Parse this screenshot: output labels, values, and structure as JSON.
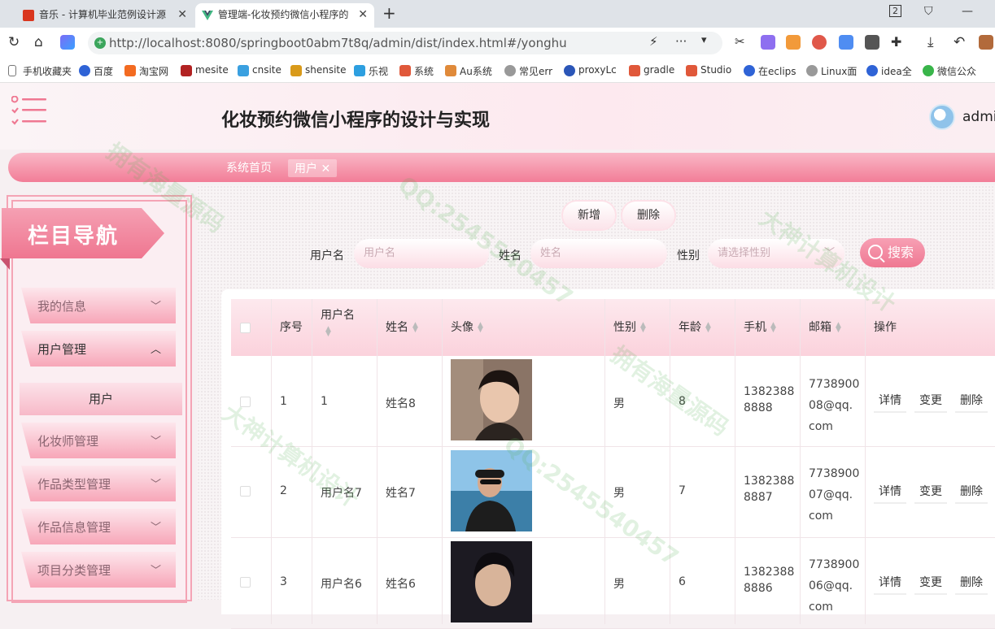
{
  "browser": {
    "tabs": [
      {
        "title": "音乐 - 计算机毕业范例设计源"
      },
      {
        "title": "管理端-化妆预约微信小程序的"
      }
    ],
    "tab_count_badge": "2",
    "url": "http://localhost:8080/springboot0abm7t8q/admin/dist/index.html#/yonghu",
    "bookmarks": [
      "手机收藏夹",
      "百度",
      "淘宝网",
      "mesite",
      "cnsite",
      "shensite",
      "乐视",
      "系统",
      "Au系统",
      "常见err",
      "proxyLc",
      "gradle",
      "Studio",
      "在eclips",
      "Linux面",
      "idea全",
      "微信公众"
    ]
  },
  "header": {
    "title": "化妆预约微信小程序的设计与实现",
    "user": "admin"
  },
  "tags": {
    "home": "系统首页",
    "current": "用户 ✕"
  },
  "sidebar": {
    "title": "栏目导航",
    "items": [
      {
        "label": "我的信息",
        "chevron": "﹀"
      },
      {
        "label": "用户管理",
        "chevron": "︿"
      },
      {
        "label": "化妆师管理",
        "chevron": "﹀"
      },
      {
        "label": "作品类型管理",
        "chevron": "﹀"
      },
      {
        "label": "作品信息管理",
        "chevron": "﹀"
      },
      {
        "label": "项目分类管理",
        "chevron": "﹀"
      }
    ],
    "sub_item": "用户"
  },
  "toolbar": {
    "add": "新增",
    "delete": "删除"
  },
  "filters": {
    "username_label": "用户名",
    "username_placeholder": "用户名",
    "name_label": "姓名",
    "name_placeholder": "姓名",
    "gender_label": "性别",
    "gender_placeholder": "请选择性别",
    "search": "搜索"
  },
  "table": {
    "columns": [
      "序号",
      "用户名",
      "姓名",
      "头像",
      "性别",
      "年龄",
      "手机",
      "邮箱",
      "操作"
    ],
    "rows": [
      {
        "index": "1",
        "username": "1",
        "name": "姓名8",
        "gender": "男",
        "age": "8",
        "phone_a": "1382388",
        "phone_b": "8888",
        "email_a": "7738900",
        "email_b": "08@qq.",
        "email_c": "com"
      },
      {
        "index": "2",
        "username": "用户名7",
        "name": "姓名7",
        "gender": "男",
        "age": "7",
        "phone_a": "1382388",
        "phone_b": "8887",
        "email_a": "7738900",
        "email_b": "07@qq.",
        "email_c": "com"
      },
      {
        "index": "3",
        "username": "用户名6",
        "name": "姓名6",
        "gender": "男",
        "age": "6",
        "phone_a": "1382388",
        "phone_b": "8886",
        "email_a": "7738900",
        "email_b": "06@qq.",
        "email_c": "com"
      }
    ],
    "actions": {
      "detail": "详情",
      "edit": "变更",
      "delete": "删除"
    }
  },
  "watermarks": [
    "大神计算机设计",
    "拥有海量源码",
    "QQ:2545540457"
  ],
  "colors": {
    "accent": "#f27d97",
    "accent_light": "#fbd2dc",
    "watermark": "#5ab45a"
  }
}
